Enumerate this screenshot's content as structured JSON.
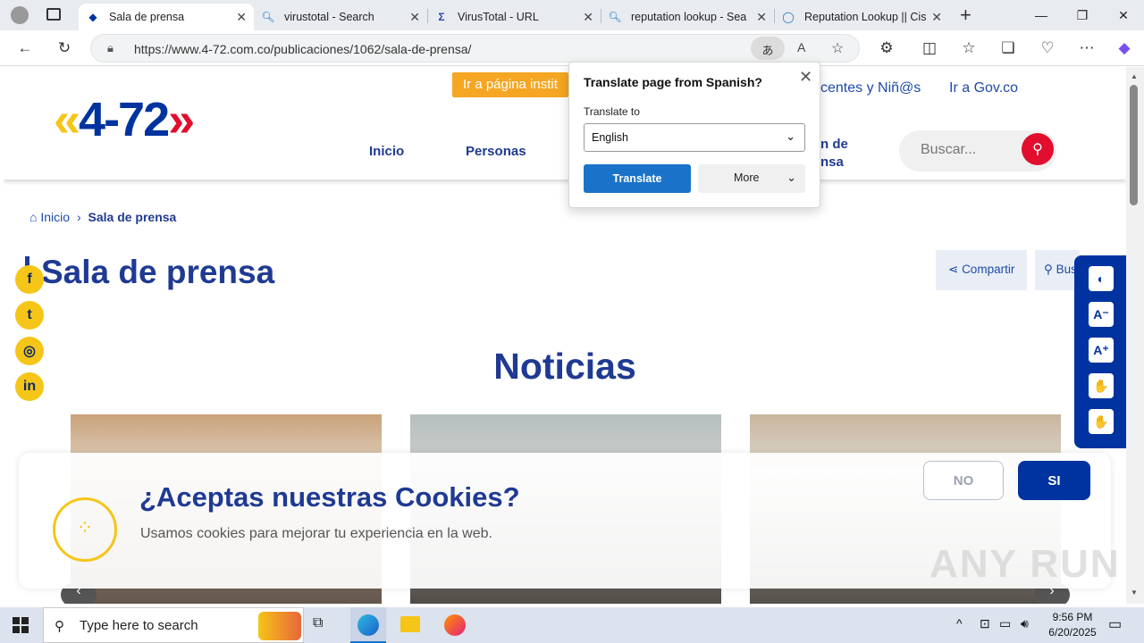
{
  "browser": {
    "tabs": [
      {
        "title": "Sala de prensa",
        "active": true
      },
      {
        "title": "virustotal - Search",
        "active": false
      },
      {
        "title": "VirusTotal - URL",
        "active": false
      },
      {
        "title": "reputation lookup - Search",
        "active": false
      },
      {
        "title": "Reputation Lookup || Cisco",
        "active": false
      }
    ],
    "url": "https://www.4-72.com.co/publicaciones/1062/sala-de-prensa/"
  },
  "translate_popup": {
    "title": "Translate page from Spanish?",
    "label": "Translate to",
    "language": "English",
    "translate_btn": "Translate",
    "more_btn": "More"
  },
  "site": {
    "logo": {
      "left": "«",
      "text": "4-72",
      "right": "»"
    },
    "top_button": "Ir a página instit",
    "top_links": [
      "centes y Niñ@s",
      "Ir a Gov.co"
    ],
    "menu": [
      "Inicio",
      "Personas",
      "n de",
      "nsa"
    ],
    "search_placeholder": "Buscar...",
    "breadcrumb": {
      "home": "Inicio",
      "current": "Sala de prensa"
    },
    "page_title": "Sala de prensa",
    "share_label": "Compartir",
    "bus_label": "Bus",
    "section_title": "Noticias"
  },
  "cookie": {
    "title": "¿Aceptas nuestras Cookies?",
    "text": "Usamos cookies para mejorar tu experiencia en la web.",
    "no": "NO",
    "yes": "SI"
  },
  "watermark": "ANY RUN",
  "taskbar": {
    "search_placeholder": "Type here to search",
    "time": "9:56 PM",
    "date": "6/20/2025"
  },
  "colors": {
    "brand_blue": "#0033a0",
    "brand_yellow": "#f5c518",
    "brand_red": "#e20e2e"
  }
}
